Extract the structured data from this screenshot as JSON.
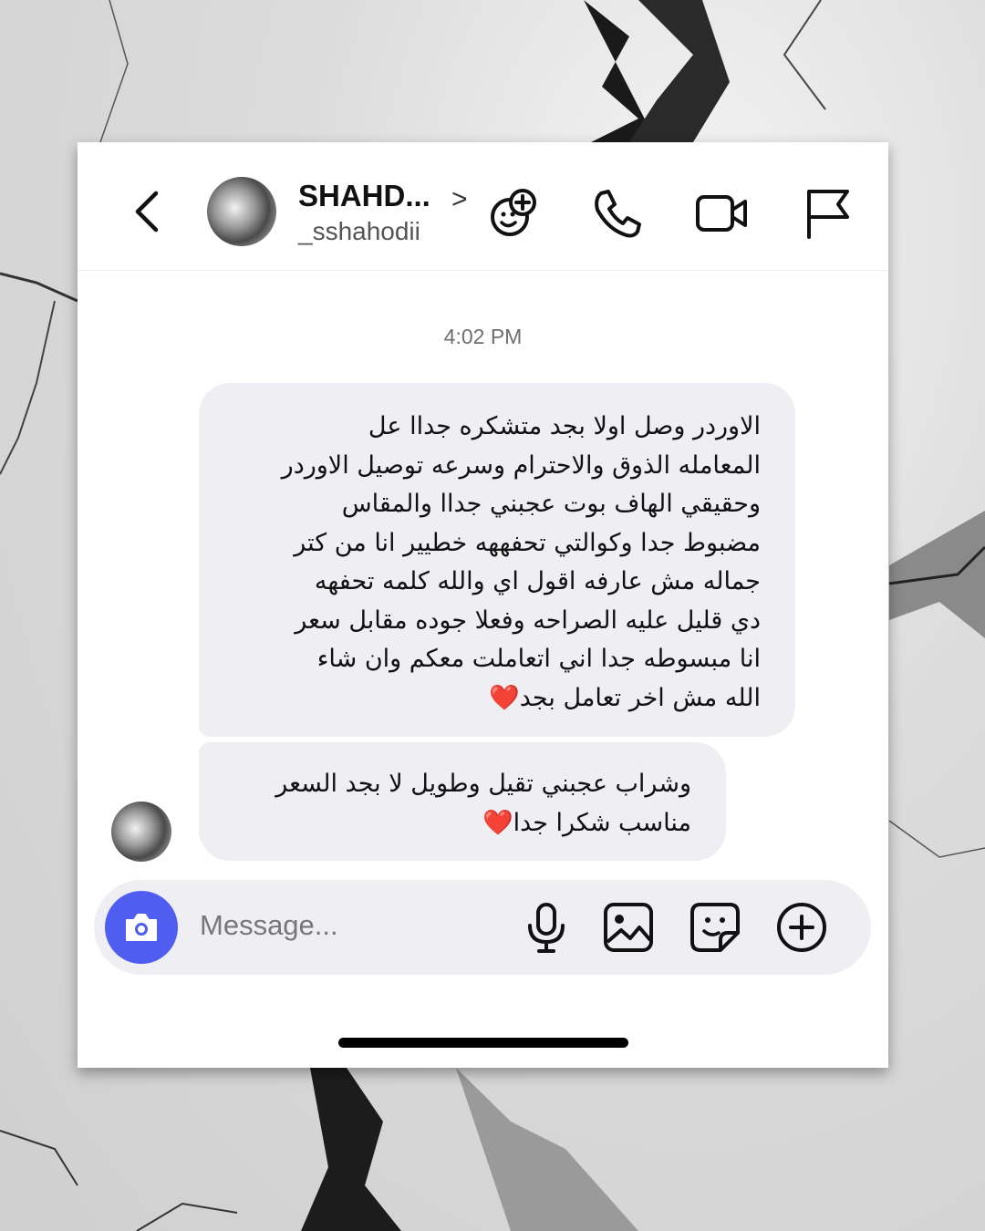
{
  "header": {
    "name": "SHAHD...",
    "chevron": ">",
    "handle": "_sshahodii",
    "icons": [
      "back-icon",
      "avatar",
      "effects-icon",
      "phone-icon",
      "video-icon",
      "flag-icon"
    ]
  },
  "thread": {
    "timestamp": "4:02 PM",
    "messages": [
      {
        "lines": [
          "الاوردر وصل اولا بجد متشكره جداا عل",
          "المعامله الذوق والاحترام وسرعه توصيل الاوردر",
          "وحقيقي الهاف بوت عجبني جداا والمقاس",
          "مضبوط جدا وكوالتي تحفههه خطيير انا من كتر",
          "جماله مش عارفه اقول اي والله كلمه تحفهه",
          "دي قليل عليه الصراحه وفعلا جوده مقابل سعر",
          "انا مبسوطه جدا اني اتعاملت معكم وان شاء",
          "الله مش اخر تعامل بجد"
        ],
        "end_emoji": "❤️"
      },
      {
        "lines": [
          "وشراب عجبني تقيل وطويل لا بجد السعر",
          "مناسب شكرا جدا"
        ],
        "end_emoji": "❤️"
      }
    ]
  },
  "composer": {
    "placeholder": "Message...",
    "icons": [
      "camera-icon",
      "microphone-icon",
      "gallery-icon",
      "sticker-icon",
      "add-icon"
    ]
  },
  "colors": {
    "accent": "#4f5ef0",
    "bubble": "#efeff3",
    "heart": "#e0241b"
  }
}
